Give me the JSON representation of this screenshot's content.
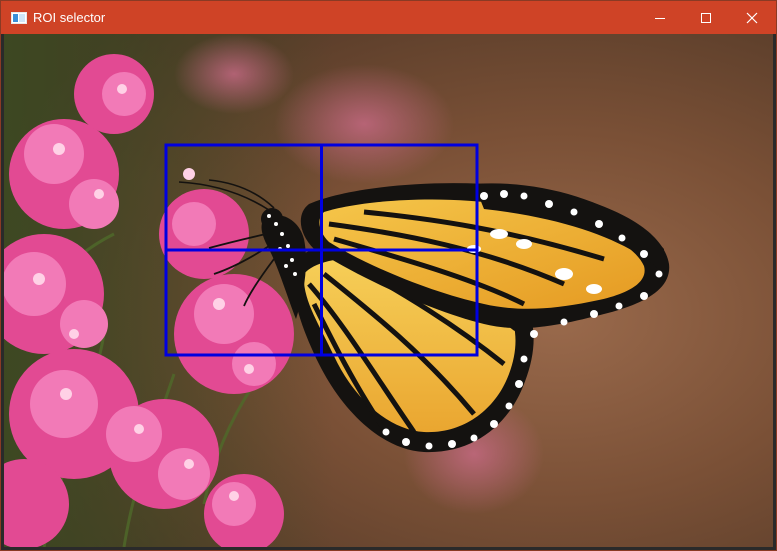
{
  "window": {
    "title": "ROI selector",
    "accent_color": "#cf4326",
    "icons": {
      "app": "window-app-icon",
      "minimize": "minimize-icon",
      "maximize": "maximize-icon",
      "close": "close-icon"
    }
  },
  "image": {
    "subject": "monarch-butterfly-on-pink-flowers"
  },
  "roi": {
    "color": "#0000e0",
    "grid_columns": 2,
    "grid_rows": 2
  }
}
